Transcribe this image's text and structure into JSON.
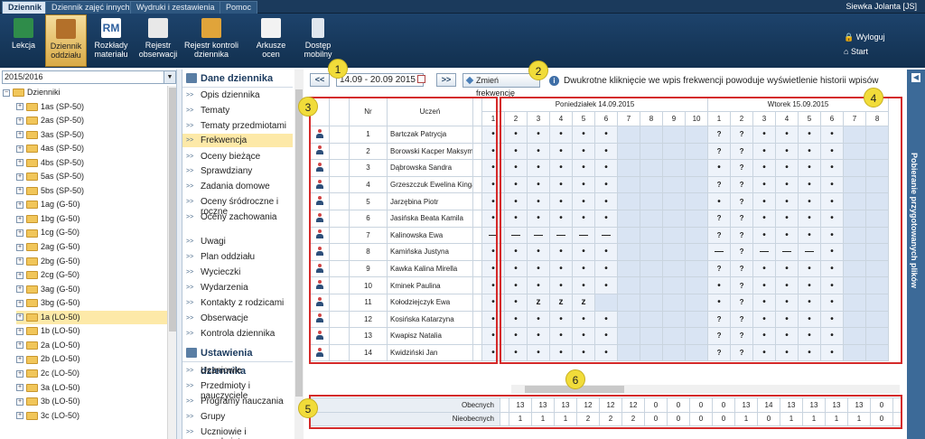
{
  "tabs": [
    "Dziennik",
    "Dziennik zajęć innych",
    "Wydruki i zestawienia",
    "Pomoc"
  ],
  "user": "Siewka Jolanta [JS]",
  "ribbon": [
    "Lekcja",
    "Dziennik oddziału",
    "Rozkłady materiału",
    "Rejestr obserwacji",
    "Rejestr kontroli dziennika",
    "Arkusze ocen",
    "Dostęp mobilny"
  ],
  "right_links": {
    "logout": "Wyloguj",
    "start": "Start"
  },
  "year": "2015/2016",
  "tree_root": "Dzienniki",
  "classes": [
    "1as (SP-50)",
    "2as (SP-50)",
    "3as (SP-50)",
    "4as (SP-50)",
    "4bs (SP-50)",
    "5as (SP-50)",
    "5bs (SP-50)",
    "1ag (G-50)",
    "1bg (G-50)",
    "1cg (G-50)",
    "2ag (G-50)",
    "2bg (G-50)",
    "2cg (G-50)",
    "3ag (G-50)",
    "3bg (G-50)",
    "1a (LO-50)",
    "1b (LO-50)",
    "2a (LO-50)",
    "2b (LO-50)",
    "2c (LO-50)",
    "3a (LO-50)",
    "3b (LO-50)",
    "3c (LO-50)"
  ],
  "selected_class": "1a (LO-50)",
  "menu_head1": "Dane dziennika",
  "menu1": [
    "Opis dziennika",
    "Tematy",
    "Tematy przedmiotami",
    "Frekwencja",
    "Oceny bieżące",
    "Sprawdziany",
    "Zadania domowe",
    "Oceny śródroczne i roczne",
    "Oceny zachowania",
    "Uwagi",
    "Plan oddziału",
    "Wycieczki",
    "Wydarzenia",
    "Kontakty z rodzicami",
    "Obserwacje",
    "Kontrola dziennika"
  ],
  "menu_head2": "Ustawienia dziennika",
  "menu2": [
    "Uczniowie",
    "Przedmioty i nauczyciele",
    "Programy nauczania",
    "Grupy",
    "Uczniowie i przedmioty"
  ],
  "toolbar": {
    "prev": "<<",
    "range": "14.09 - 20.09 2015",
    "next": ">>",
    "change": "Zmień frekwencję",
    "info": "Dwukrotne kliknięcie we wpis frekwencji powoduje wyświetlenie historii wpisów"
  },
  "table": {
    "nr": "Nr",
    "student": "Uczeń",
    "day1": "Poniedziałek 14.09.2015",
    "day2": "Wtorek 15.09.2015",
    "day1_lessons": [
      "1",
      "2",
      "3",
      "4",
      "5",
      "6",
      "7",
      "8",
      "9",
      "10"
    ],
    "day2_lessons": [
      "1",
      "2",
      "3",
      "4",
      "5",
      "6",
      "7",
      "8"
    ],
    "students": [
      {
        "nr": "1",
        "name": "Bartczak Patrycja",
        "d1": [
          "•",
          "•",
          "•",
          "•",
          "•",
          "•",
          "",
          "",
          "",
          ""
        ],
        "d2": [
          "?",
          "?",
          "•",
          "•",
          "•",
          "•",
          "",
          ""
        ]
      },
      {
        "nr": "2",
        "name": "Borowski Kacper Maksymilian",
        "d1": [
          "•",
          "•",
          "•",
          "•",
          "•",
          "•",
          "",
          "",
          "",
          ""
        ],
        "d2": [
          "?",
          "?",
          "•",
          "•",
          "•",
          "•",
          "",
          ""
        ]
      },
      {
        "nr": "3",
        "name": "Dąbrowska Sandra",
        "d1": [
          "•",
          "•",
          "•",
          "•",
          "•",
          "•",
          "",
          "",
          "",
          ""
        ],
        "d2": [
          "•",
          "?",
          "•",
          "•",
          "•",
          "•",
          "",
          ""
        ]
      },
      {
        "nr": "4",
        "name": "Grzeszczuk Ewelina Kinga",
        "d1": [
          "•",
          "•",
          "•",
          "•",
          "•",
          "•",
          "",
          "",
          "",
          ""
        ],
        "d2": [
          "?",
          "?",
          "•",
          "•",
          "•",
          "•",
          "",
          ""
        ]
      },
      {
        "nr": "5",
        "name": "Jarzębina Piotr",
        "d1": [
          "•",
          "•",
          "•",
          "•",
          "•",
          "•",
          "",
          "",
          "",
          ""
        ],
        "d2": [
          "•",
          "?",
          "•",
          "•",
          "•",
          "•",
          "",
          ""
        ]
      },
      {
        "nr": "6",
        "name": "Jasińska Beata Kamila",
        "d1": [
          "•",
          "•",
          "•",
          "•",
          "•",
          "•",
          "",
          "",
          "",
          ""
        ],
        "d2": [
          "?",
          "?",
          "•",
          "•",
          "•",
          "•",
          "",
          ""
        ]
      },
      {
        "nr": "7",
        "name": "Kalinowska Ewa",
        "d1": [
          "—",
          "—",
          "—",
          "—",
          "—",
          "—",
          "",
          "",
          "",
          ""
        ],
        "d2": [
          "?",
          "?",
          "•",
          "•",
          "•",
          "•",
          "",
          ""
        ]
      },
      {
        "nr": "8",
        "name": "Kamińska Justyna",
        "d1": [
          "•",
          "•",
          "•",
          "•",
          "•",
          "•",
          "",
          "",
          "",
          ""
        ],
        "d2": [
          "—",
          "?",
          "—",
          "—",
          "—",
          "•",
          "",
          ""
        ]
      },
      {
        "nr": "9",
        "name": "Kawka Kalina Mirella",
        "d1": [
          "•",
          "•",
          "•",
          "•",
          "•",
          "•",
          "",
          "",
          "",
          ""
        ],
        "d2": [
          "?",
          "?",
          "•",
          "•",
          "•",
          "•",
          "",
          ""
        ]
      },
      {
        "nr": "10",
        "name": "Kminek Paulina",
        "d1": [
          "•",
          "•",
          "•",
          "•",
          "•",
          "•",
          "",
          "",
          "",
          ""
        ],
        "d2": [
          "•",
          "?",
          "•",
          "•",
          "•",
          "•",
          "",
          ""
        ]
      },
      {
        "nr": "11",
        "name": "Kołodziejczyk Ewa",
        "d1": [
          "•",
          "•",
          "z",
          "z",
          "z",
          "",
          "",
          "",
          "",
          ""
        ],
        "d2": [
          "•",
          "?",
          "•",
          "•",
          "•",
          "•",
          "",
          ""
        ]
      },
      {
        "nr": "12",
        "name": "Kosińska Katarzyna",
        "d1": [
          "•",
          "•",
          "•",
          "•",
          "•",
          "•",
          "",
          "",
          "",
          ""
        ],
        "d2": [
          "?",
          "?",
          "•",
          "•",
          "•",
          "•",
          "",
          ""
        ]
      },
      {
        "nr": "13",
        "name": "Kwapisz Natalia",
        "d1": [
          "•",
          "•",
          "•",
          "•",
          "•",
          "•",
          "",
          "",
          "",
          ""
        ],
        "d2": [
          "?",
          "?",
          "•",
          "•",
          "•",
          "•",
          "",
          ""
        ]
      },
      {
        "nr": "14",
        "name": "Kwidziński Jan",
        "d1": [
          "•",
          "•",
          "•",
          "•",
          "•",
          "•",
          "",
          "",
          "",
          ""
        ],
        "d2": [
          "?",
          "?",
          "•",
          "•",
          "•",
          "•",
          "",
          ""
        ]
      }
    ]
  },
  "summary": {
    "present_label": "Obecnych",
    "absent_label": "Nieobecnych",
    "present": [
      "13",
      "13",
      "13",
      "12",
      "12",
      "12",
      "0",
      "0",
      "0",
      "0",
      "13",
      "14",
      "13",
      "13",
      "13",
      "13",
      "0",
      "0"
    ],
    "absent": [
      "1",
      "1",
      "1",
      "2",
      "2",
      "2",
      "0",
      "0",
      "0",
      "0",
      "1",
      "0",
      "1",
      "1",
      "1",
      "1",
      "0",
      "0"
    ]
  },
  "badges": [
    "1",
    "2",
    "3",
    "4",
    "5",
    "6"
  ],
  "side_panel": "Pobieranie przygotowanych plików"
}
